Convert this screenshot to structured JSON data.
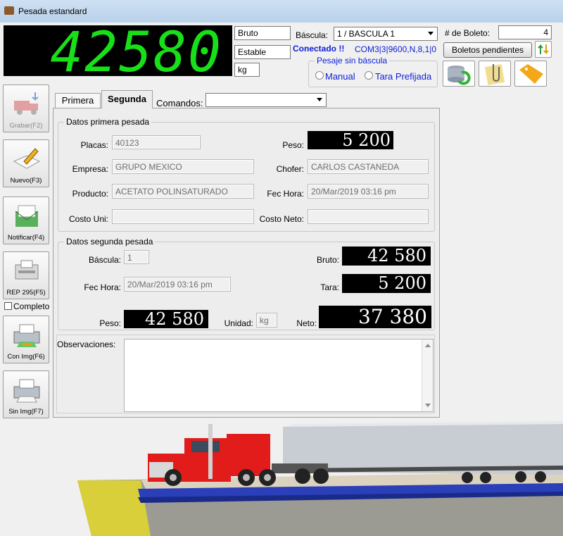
{
  "window": {
    "title": "Pesada estandard"
  },
  "display": {
    "weight": "42580"
  },
  "status": {
    "mode": "Bruto",
    "stability": "Estable",
    "unit": "kg"
  },
  "scale": {
    "label": "Báscula:",
    "selected": "1 / BASCULA 1",
    "connection": "Conectado !!",
    "port": "COM3|3|9600,N,8,1|0"
  },
  "ticket": {
    "label": "# de Boleto:",
    "number": "4",
    "pending_button": "Boletos pendientes"
  },
  "manual_group": {
    "title": "Pesaje sin báscula",
    "manual": "Manual",
    "tare": "Tara Prefijada"
  },
  "sidebar": {
    "save": "Grabar(F2)",
    "new": "Nuevo(F3)",
    "notify": "Notificar(F4)",
    "report": "REP 295(F5)",
    "complete": "Completo",
    "with_img": "Con Img(F6)",
    "without_img": "Sin Img(F7)"
  },
  "tabs": {
    "first": "Primera",
    "second": "Segunda",
    "commands_label": "Comandos:",
    "commands_value": ""
  },
  "first_weighing": {
    "title": "Datos primera pesada",
    "plates_label": "Placas:",
    "plates": "40123",
    "weight_label": "Peso:",
    "weight": "5 200",
    "company_label": "Empresa:",
    "company": "GRUPO MEXICO",
    "driver_label": "Chofer:",
    "driver": "CARLOS CASTANEDA",
    "product_label": "Producto:",
    "product": "ACETATO POLINSATURADO",
    "datetime_label": "Fec Hora:",
    "datetime": "20/Mar/2019 03:16 pm",
    "unit_cost_label": "Costo Uni:",
    "unit_cost": "",
    "net_cost_label": "Costo Neto:",
    "net_cost": ""
  },
  "second_weighing": {
    "title": "Datos segunda pesada",
    "scale_label": "Báscula:",
    "scale": "1",
    "gross_label": "Bruto:",
    "gross": "42 580",
    "datetime_label": "Fec Hora:",
    "datetime": "20/Mar/2019 03:16 pm",
    "tare_label": "Tara:",
    "tare": "5 200",
    "weight_label": "Peso:",
    "weight": "42 580",
    "unit_label": "Unidad:",
    "unit": "kg",
    "net_label": "Neto:",
    "net": "37 380"
  },
  "observations": {
    "label": "Observaciones:",
    "text": ""
  },
  "colors": {
    "lcd_green": "#18e018",
    "link_blue": "#0b1fd6",
    "truck_red": "#e21b1b",
    "scale_blue": "#2a3fb8"
  }
}
